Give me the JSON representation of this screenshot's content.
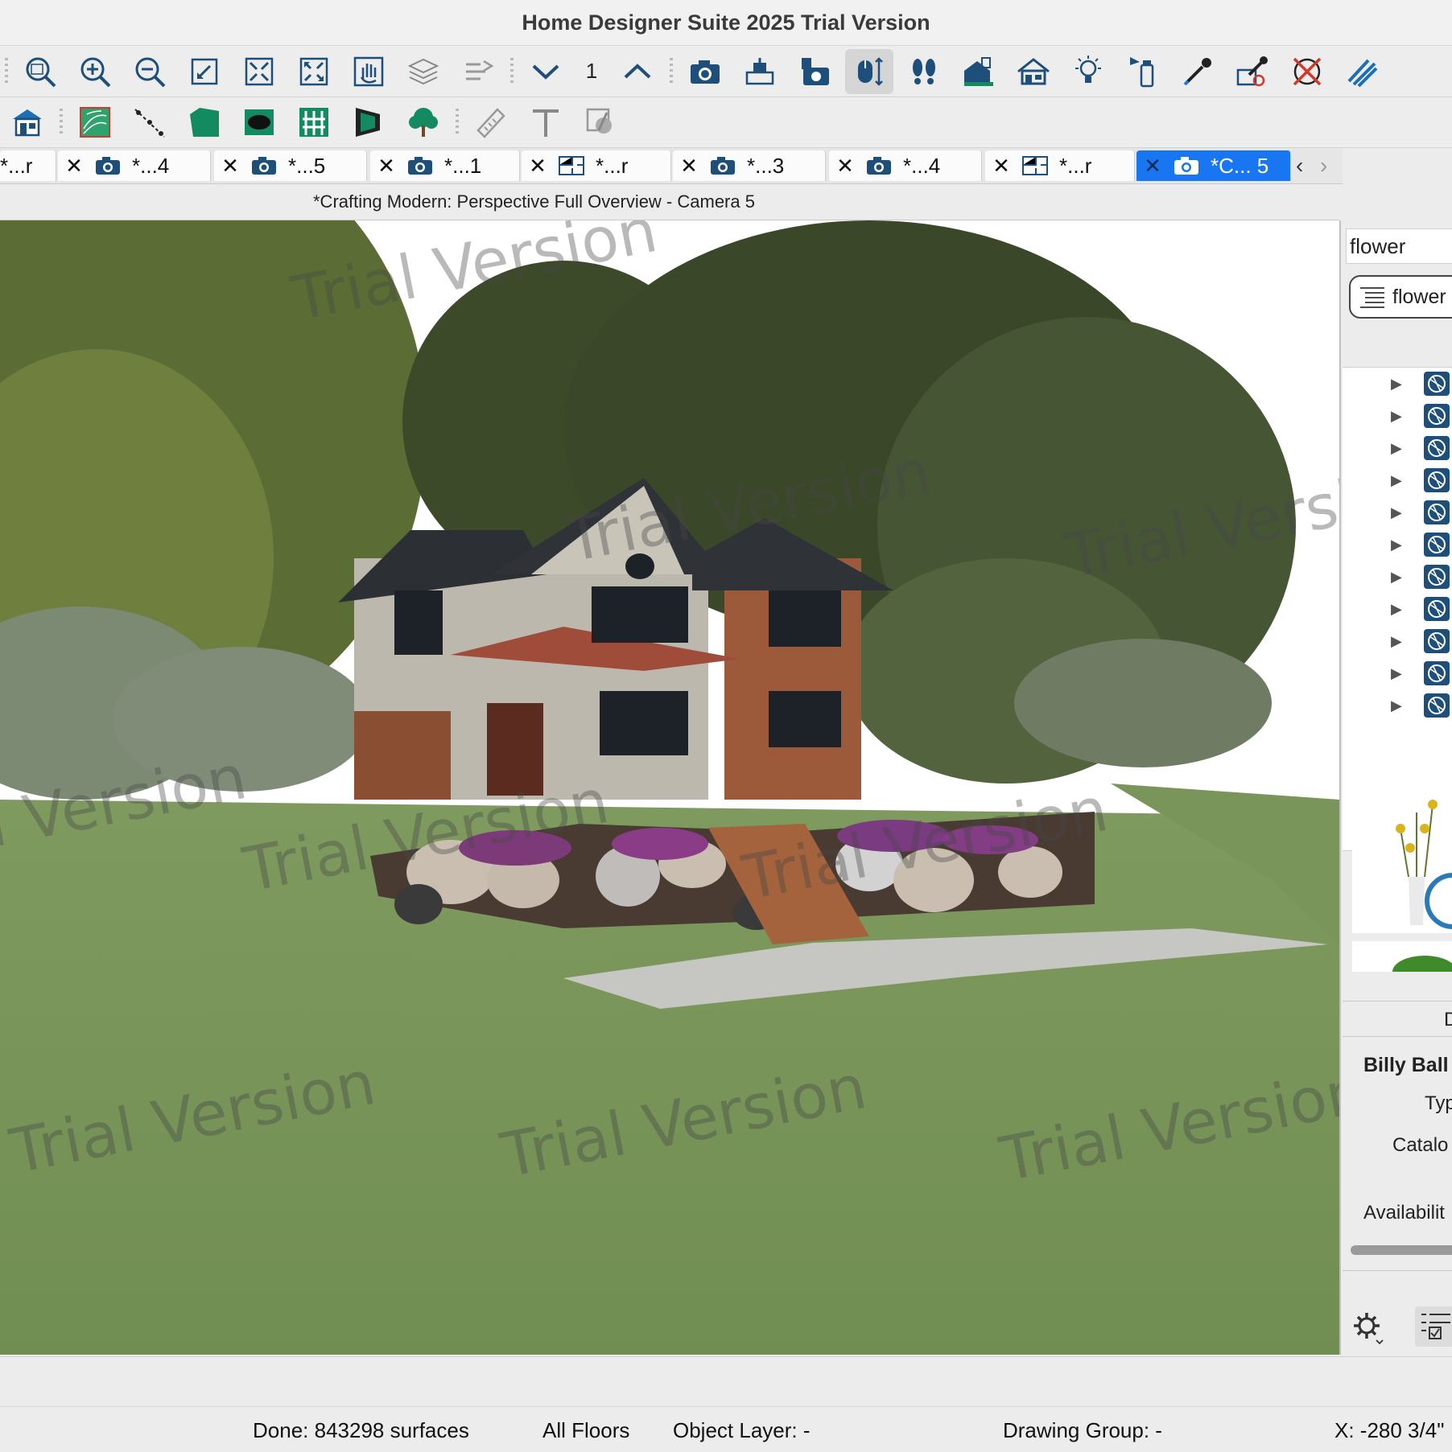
{
  "window": {
    "title": "Home Designer Suite 2025 Trial Version"
  },
  "toolbar": {
    "floor_number": "1",
    "row1_icons": [
      "zoom-icon",
      "zoom-in-icon",
      "zoom-out-icon",
      "undo-zoom-icon",
      "fill-window-icon",
      "fill-window-all-floors-icon",
      "pan-icon",
      "layer-icon",
      "reference-display-icon",
      "floor-down-icon",
      "floor-up-icon",
      "camera-icon",
      "camera-ceiling-icon",
      "camera-save-icon",
      "mouse-orbit-icon",
      "walkthrough-icon",
      "house-build-icon",
      "home-icon",
      "light-bulb-icon",
      "spray-paint-icon",
      "eyedropper-icon",
      "material-painter-icon",
      "delete-material-icon",
      "wall-hatch-icon"
    ],
    "row2_icons": [
      "house-icon",
      "terrain-icon",
      "terrain-path-icon",
      "terrain-region-icon",
      "terrain-hole-icon",
      "fence-icon",
      "retaining-wall-icon",
      "plant-icon",
      "dimension-icon",
      "text-icon",
      "callout-icon"
    ]
  },
  "tabs": [
    {
      "label": "*...r",
      "icon": "camera-icon"
    },
    {
      "label": "*...4",
      "icon": "camera-icon"
    },
    {
      "label": "*...5",
      "icon": "camera-icon"
    },
    {
      "label": "*...1",
      "icon": "camera-icon"
    },
    {
      "label": "*...r",
      "icon": "floor-plan-icon"
    },
    {
      "label": "*...3",
      "icon": "camera-icon"
    },
    {
      "label": "*...4",
      "icon": "camera-icon"
    },
    {
      "label": "*...r",
      "icon": "floor-plan-icon"
    },
    {
      "label": "*C... 5",
      "icon": "camera-icon",
      "active": true
    }
  ],
  "view": {
    "title": "*Crafting Modern: Perspective Full Overview - Camera 5",
    "watermark": "Trial Version"
  },
  "library": {
    "search_value": "flower",
    "filter_label": "flower",
    "item_name": "Billy Ball",
    "prop_type": "Typ",
    "prop_catalog": "Catalo",
    "prop_availability": "Availabilit",
    "prop_col": "D"
  },
  "status": {
    "done": "Done:  843298 surfaces",
    "floors": "All Floors",
    "layer": "Object Layer: -",
    "group": "Drawing Group: -",
    "coords": "X: -280 3/4\""
  },
  "colors": {
    "accent": "#1876f2",
    "icon_blue": "#1d4f7a",
    "icon_teal": "#138a60"
  }
}
